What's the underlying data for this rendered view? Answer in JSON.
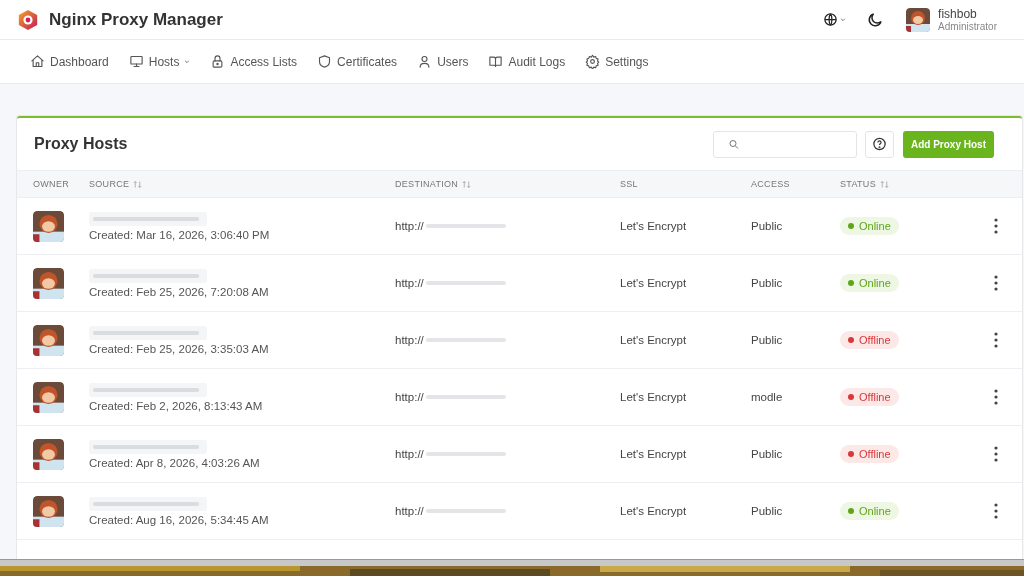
{
  "app": {
    "title": "Nginx Proxy Manager"
  },
  "user": {
    "name": "fishbob",
    "role": "Administrator"
  },
  "nav": [
    {
      "label": "Dashboard",
      "dropdown": false
    },
    {
      "label": "Hosts",
      "dropdown": true
    },
    {
      "label": "Access Lists",
      "dropdown": false
    },
    {
      "label": "Certificates",
      "dropdown": false
    },
    {
      "label": "Users",
      "dropdown": false
    },
    {
      "label": "Audit Logs",
      "dropdown": false
    },
    {
      "label": "Settings",
      "dropdown": false
    }
  ],
  "card": {
    "title": "Proxy Hosts",
    "add_button": "Add Proxy Host"
  },
  "table": {
    "columns": [
      {
        "label": "OWNER",
        "sortable": false
      },
      {
        "label": "SOURCE",
        "sortable": true
      },
      {
        "label": "DESTINATION",
        "sortable": true
      },
      {
        "label": "SSL",
        "sortable": false
      },
      {
        "label": "ACCESS",
        "sortable": false
      },
      {
        "label": "STATUS",
        "sortable": true
      }
    ],
    "rows": [
      {
        "created": "Created: Mar 16, 2026, 3:06:40 PM",
        "destination": "http://",
        "ssl": "Let's Encrypt",
        "access": "Public",
        "status": "Online",
        "online": true
      },
      {
        "created": "Created: Feb 25, 2026, 7:20:08 AM",
        "destination": "http://",
        "ssl": "Let's Encrypt",
        "access": "Public",
        "status": "Online",
        "online": true
      },
      {
        "created": "Created: Feb 25, 2026, 3:35:03 AM",
        "destination": "http://",
        "ssl": "Let's Encrypt",
        "access": "Public",
        "status": "Offline",
        "online": false
      },
      {
        "created": "Created: Feb 2, 2026, 8:13:43 AM",
        "destination": "http://",
        "ssl": "Let's Encrypt",
        "access": "modle",
        "status": "Offline",
        "online": false
      },
      {
        "created": "Created: Apr 8, 2026, 4:03:26 AM",
        "destination": "http://",
        "ssl": "Let's Encrypt",
        "access": "Public",
        "status": "Offline",
        "online": false
      },
      {
        "created": "Created: Aug 16, 2026, 5:34:45 AM",
        "destination": "http://",
        "ssl": "Let's Encrypt",
        "access": "Public",
        "status": "Online",
        "online": true
      }
    ]
  }
}
